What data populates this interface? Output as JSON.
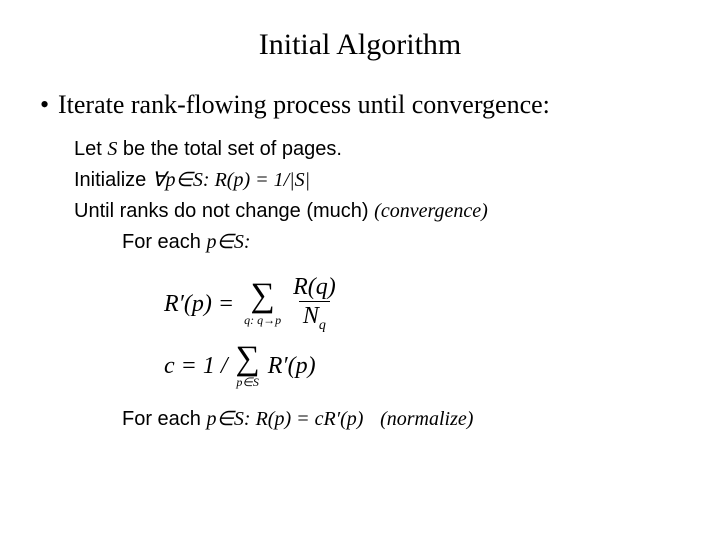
{
  "title": "Initial Algorithm",
  "bullet_text": "Iterate rank-flowing process until convergence:",
  "lines": {
    "let_prefix": "Let ",
    "let_var": "S",
    "let_suffix": " be the total set of pages.",
    "init_prefix": "Initialize ",
    "init_quant": "∀p∈S: R(p) = 1/|S|",
    "until": "Until ranks do not change (much)  ",
    "convergence": "(convergence)",
    "foreach_prefix": "For each ",
    "foreach_cond": "p∈S:",
    "foreach2_prefix": "For each ",
    "foreach2_cond": "p∈S: R(p) = cR′(p)",
    "normalize": "(normalize)"
  },
  "formula1": {
    "lhs": "R′(p) =",
    "sigma_sub": "q: q→p",
    "frac_num": "R(q)",
    "frac_den_base": "N",
    "frac_den_sub": "q"
  },
  "formula2": {
    "lhs": "c = 1 /",
    "sigma_sub": "p∈S",
    "rhs": "R′(p)"
  }
}
